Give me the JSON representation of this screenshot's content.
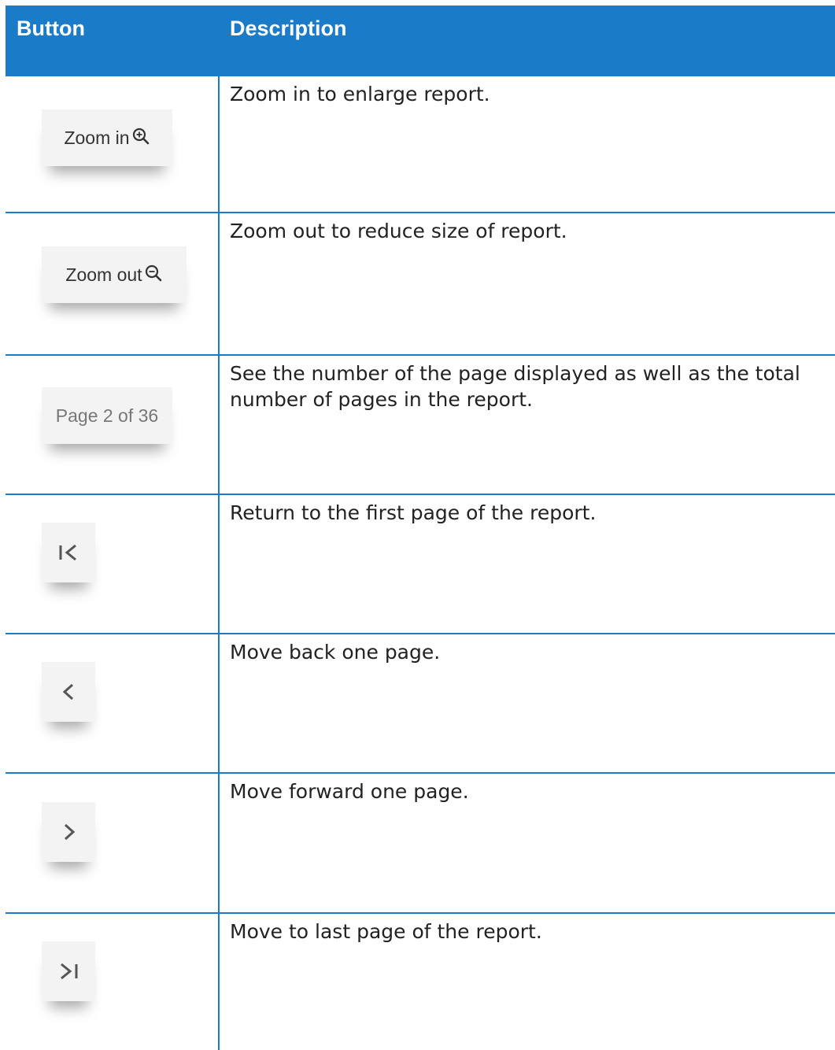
{
  "header": {
    "button_col": "Button",
    "description_col": "Description"
  },
  "rows": [
    {
      "button_label": "Zoom in",
      "icon": "zoom-in-icon",
      "description": "Zoom in to enlarge report."
    },
    {
      "button_label": "Zoom out",
      "icon": "zoom-out-icon",
      "description": "Zoom out to reduce size of report."
    },
    {
      "button_label": "Page 2 of 36",
      "icon": "",
      "description": "See the number of the page displayed as well as the total number of pages in the report."
    },
    {
      "button_label": "",
      "icon": "first-page-icon",
      "description": "Return to the first page of the report."
    },
    {
      "button_label": "",
      "icon": "previous-page-icon",
      "description": "Move back one page."
    },
    {
      "button_label": "",
      "icon": "next-page-icon",
      "description": "Move forward one page."
    },
    {
      "button_label": "",
      "icon": "last-page-icon",
      "description": "Move to last page of the report."
    }
  ],
  "colors": {
    "header_bg": "#1a7bc9",
    "header_text": "#ffffff",
    "border": "#1a7bc9"
  }
}
